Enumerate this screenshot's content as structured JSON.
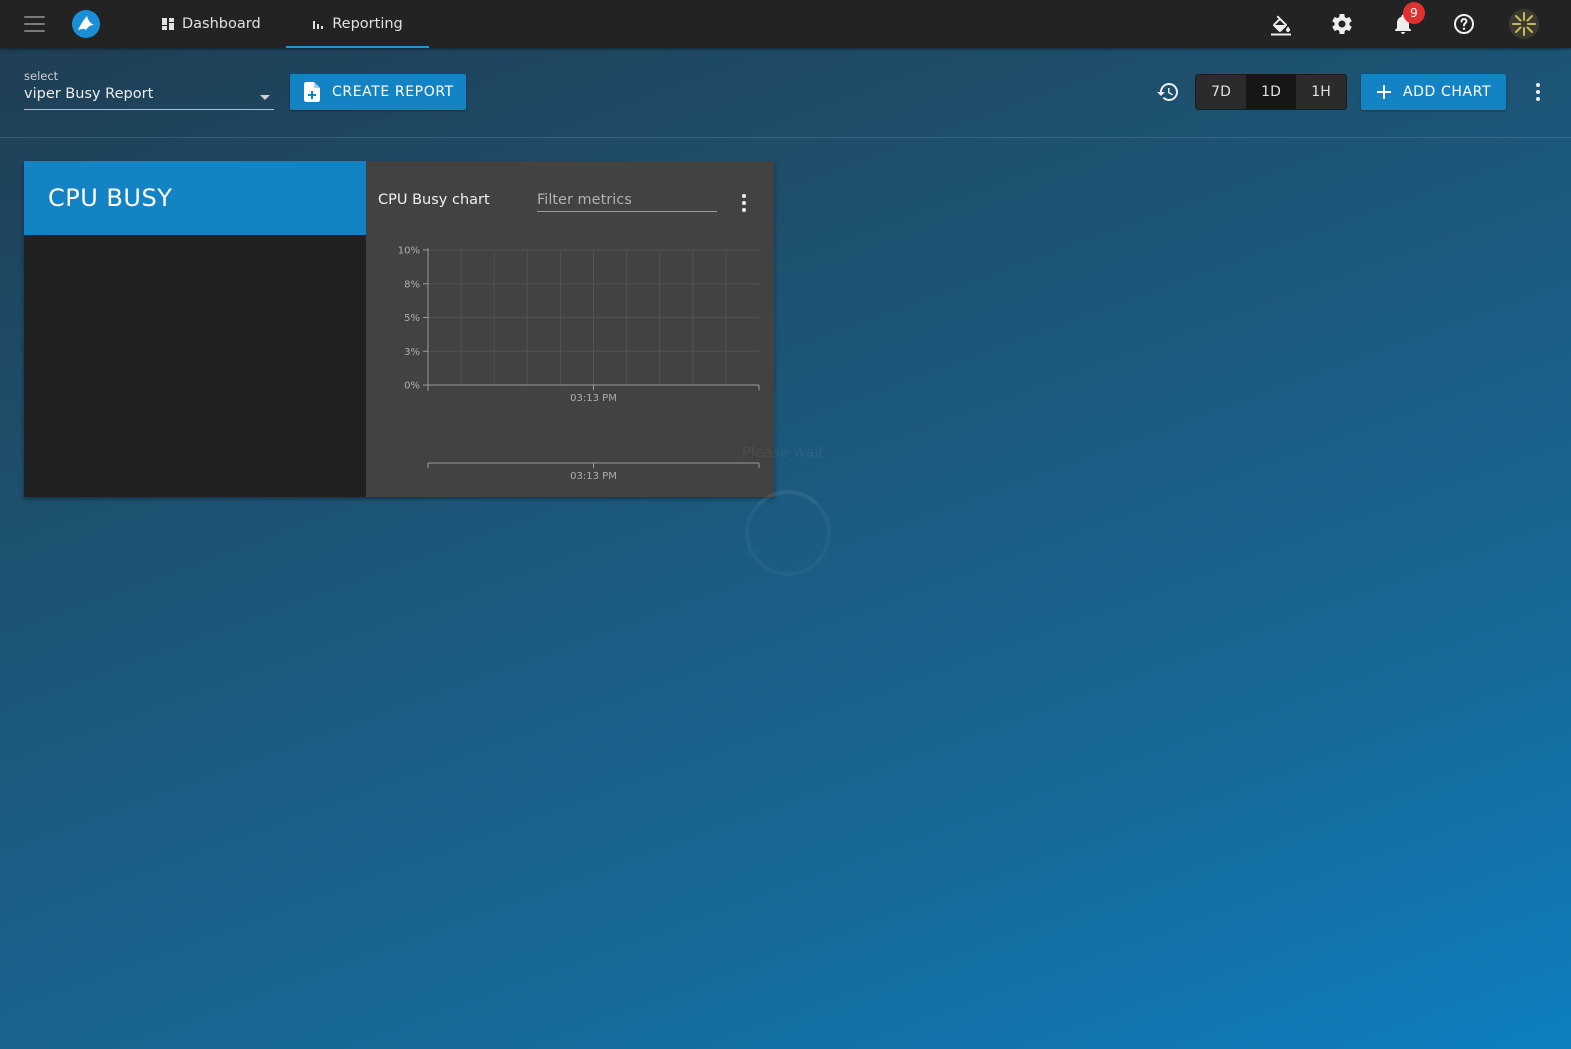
{
  "topbar": {
    "nav": [
      {
        "label": "Dashboard",
        "icon": "dashboard-icon"
      },
      {
        "label": "Reporting",
        "icon": "bar-chart-icon",
        "active": true
      }
    ],
    "notifications_count": "9",
    "icons": [
      "paint-bucket-icon",
      "gear-icon",
      "bell-icon",
      "help-icon",
      "avatar"
    ]
  },
  "toolbar": {
    "select_label": "select",
    "select_value": "viper Busy Report",
    "create_report_label": "CREATE REPORT",
    "ranges": [
      "7D",
      "1D",
      "1H"
    ],
    "active_range": "1D",
    "add_chart_label": "ADD CHART"
  },
  "report": {
    "title": "CPU BUSY",
    "chart": {
      "title": "CPU Busy chart",
      "filter_placeholder": "Filter metrics"
    }
  },
  "overlay": {
    "text": "Please wait"
  },
  "colors": {
    "accent": "#1483c4",
    "topbar": "#232323",
    "card": "#424242",
    "panel": "#212121",
    "badge": "#e03131"
  },
  "chart_data": {
    "type": "line",
    "title": "CPU Busy chart",
    "xlabel": "",
    "ylabel": "",
    "y_ticks": [
      "10%",
      "8%",
      "5%",
      "3%",
      "0%"
    ],
    "x_ticks": [
      "03:13 PM"
    ],
    "navigator_x_ticks": [
      "03:13 PM"
    ],
    "ylim": [
      0,
      10
    ],
    "series": [],
    "grid": true
  }
}
